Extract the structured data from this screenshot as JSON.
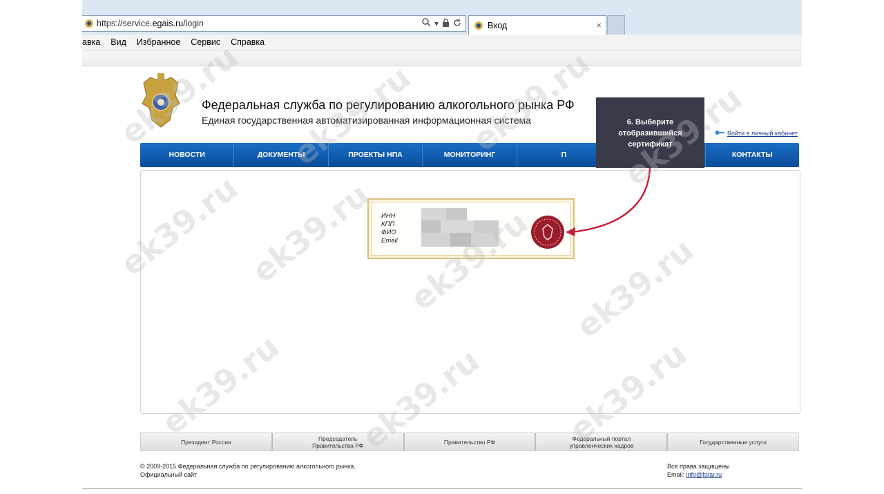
{
  "browser": {
    "url_prefix": "https://service.",
    "url_domain": "egais.ru",
    "url_path": "/login",
    "tab_title": "Вход",
    "tab_close": "×",
    "menu": [
      "авка",
      "Вид",
      "Избранное",
      "Сервис",
      "Справка"
    ]
  },
  "header": {
    "title": "Федеральная служба по регулированию алкогольного рынка РФ",
    "subtitle": "Единая государственная автоматизированная информационная система",
    "login_link": "Войти в личный кабинет"
  },
  "nav": {
    "items": [
      "НОВОСТИ",
      "ДОКУМЕНТЫ",
      "ПРОЕКТЫ НПА",
      "МОНИТОРИНГ",
      "П",
      "",
      "КОНТАКТЫ"
    ]
  },
  "certificate": {
    "labels": [
      "ИНН",
      "КПП",
      "ФИО",
      "Email"
    ]
  },
  "callout": {
    "line1": "6. Выберите",
    "line2": "отобразившийся",
    "line3": "сертификат"
  },
  "footer": {
    "links": [
      {
        "line1": "Президент России",
        "line2": ""
      },
      {
        "line1": "Председатель",
        "line2": "Правительства РФ"
      },
      {
        "line1": "Правительство РФ",
        "line2": ""
      },
      {
        "line1": "Федеральный портал",
        "line2": "управленческих кадров"
      },
      {
        "line1": "Государственные услуги",
        "line2": ""
      }
    ],
    "copyright_line1": "© 2009-2015 Федеральная служба по регулированию алкогольного рынка.",
    "copyright_line2": "Официальный сайт",
    "rights_line1": "Все права защищены",
    "email_label": "Email: ",
    "email": "info@fsrar.ru"
  },
  "watermark": "ek39.ru",
  "colors": {
    "nav_blue": "#0a4c9a",
    "callout_bg": "#3a3b4a",
    "arrow_red": "#c8203b",
    "seal_red": "#9b1c2a"
  }
}
